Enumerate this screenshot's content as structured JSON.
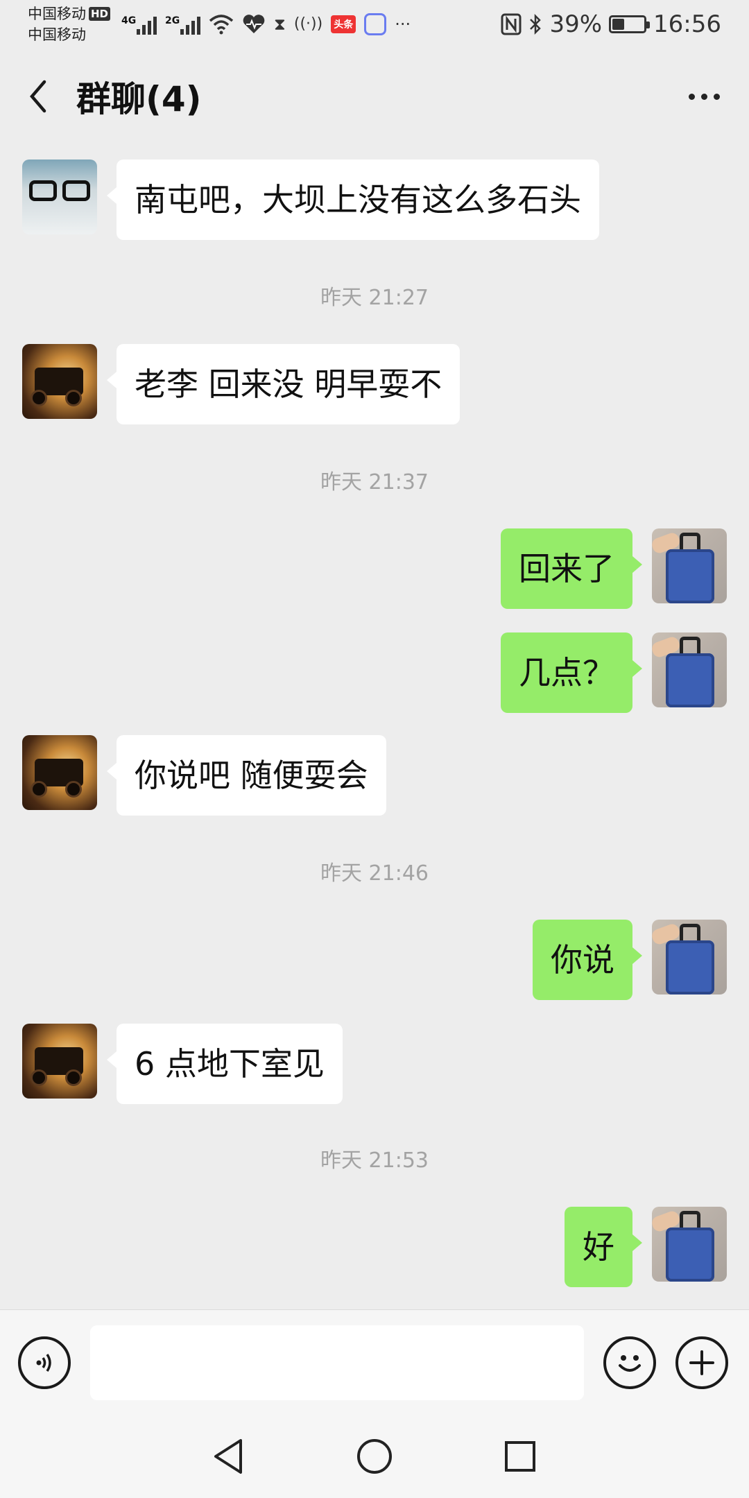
{
  "status_bar": {
    "carrier_1": "中国移动",
    "carrier_2": "中国移动",
    "hd_label": "HD",
    "net_1": "4G",
    "net_2": "2G",
    "app_badge_label": "头条",
    "overflow_dots": "···",
    "battery_percent": "39%",
    "battery_level": 0.39,
    "time": "16:56",
    "icons": [
      "signal-icon",
      "wifi-icon",
      "heart-rate-icon",
      "hourglass-icon",
      "hotspot-icon",
      "toutiao-app-icon",
      "chat-app-icon",
      "nfc-icon",
      "bluetooth-icon",
      "battery-icon"
    ]
  },
  "header": {
    "title": "群聊(4)",
    "back_icon": "chevron-left-icon",
    "more_icon": "more-dots-icon"
  },
  "messages": [
    {
      "type": "message",
      "side": "left",
      "avatar": "glasses",
      "text": "南屯吧，大坝上没有这么多石头"
    },
    {
      "type": "timestamp",
      "text": "昨天 21:27"
    },
    {
      "type": "message",
      "side": "left",
      "avatar": "jeep",
      "text": "老李 回来没 明早耍不"
    },
    {
      "type": "timestamp",
      "text": "昨天 21:37"
    },
    {
      "type": "message",
      "side": "right",
      "avatar": "bag",
      "text": "回来了"
    },
    {
      "type": "message",
      "side": "right",
      "avatar": "bag",
      "text": "几点？"
    },
    {
      "type": "message",
      "side": "left",
      "avatar": "jeep",
      "text": "你说吧 随便耍会"
    },
    {
      "type": "timestamp",
      "text": "昨天 21:46"
    },
    {
      "type": "message",
      "side": "right",
      "avatar": "bag",
      "text": "你说"
    },
    {
      "type": "message",
      "side": "left",
      "avatar": "jeep",
      "text": "6 点地下室见"
    },
    {
      "type": "timestamp",
      "text": "昨天 21:53"
    },
    {
      "type": "message",
      "side": "right",
      "avatar": "bag",
      "text": "好"
    }
  ],
  "input_bar": {
    "value": "",
    "voice_icon": "voice-icon",
    "emoji_icon": "emoji-icon",
    "plus_icon": "plus-icon"
  },
  "nav_bar": {
    "icons": [
      "nav-back-icon",
      "nav-home-icon",
      "nav-recents-icon"
    ]
  },
  "colors": {
    "background": "#ededed",
    "bubble_self": "#95ec69",
    "bubble_other": "#ffffff",
    "timestamp": "#a3a3a3"
  }
}
